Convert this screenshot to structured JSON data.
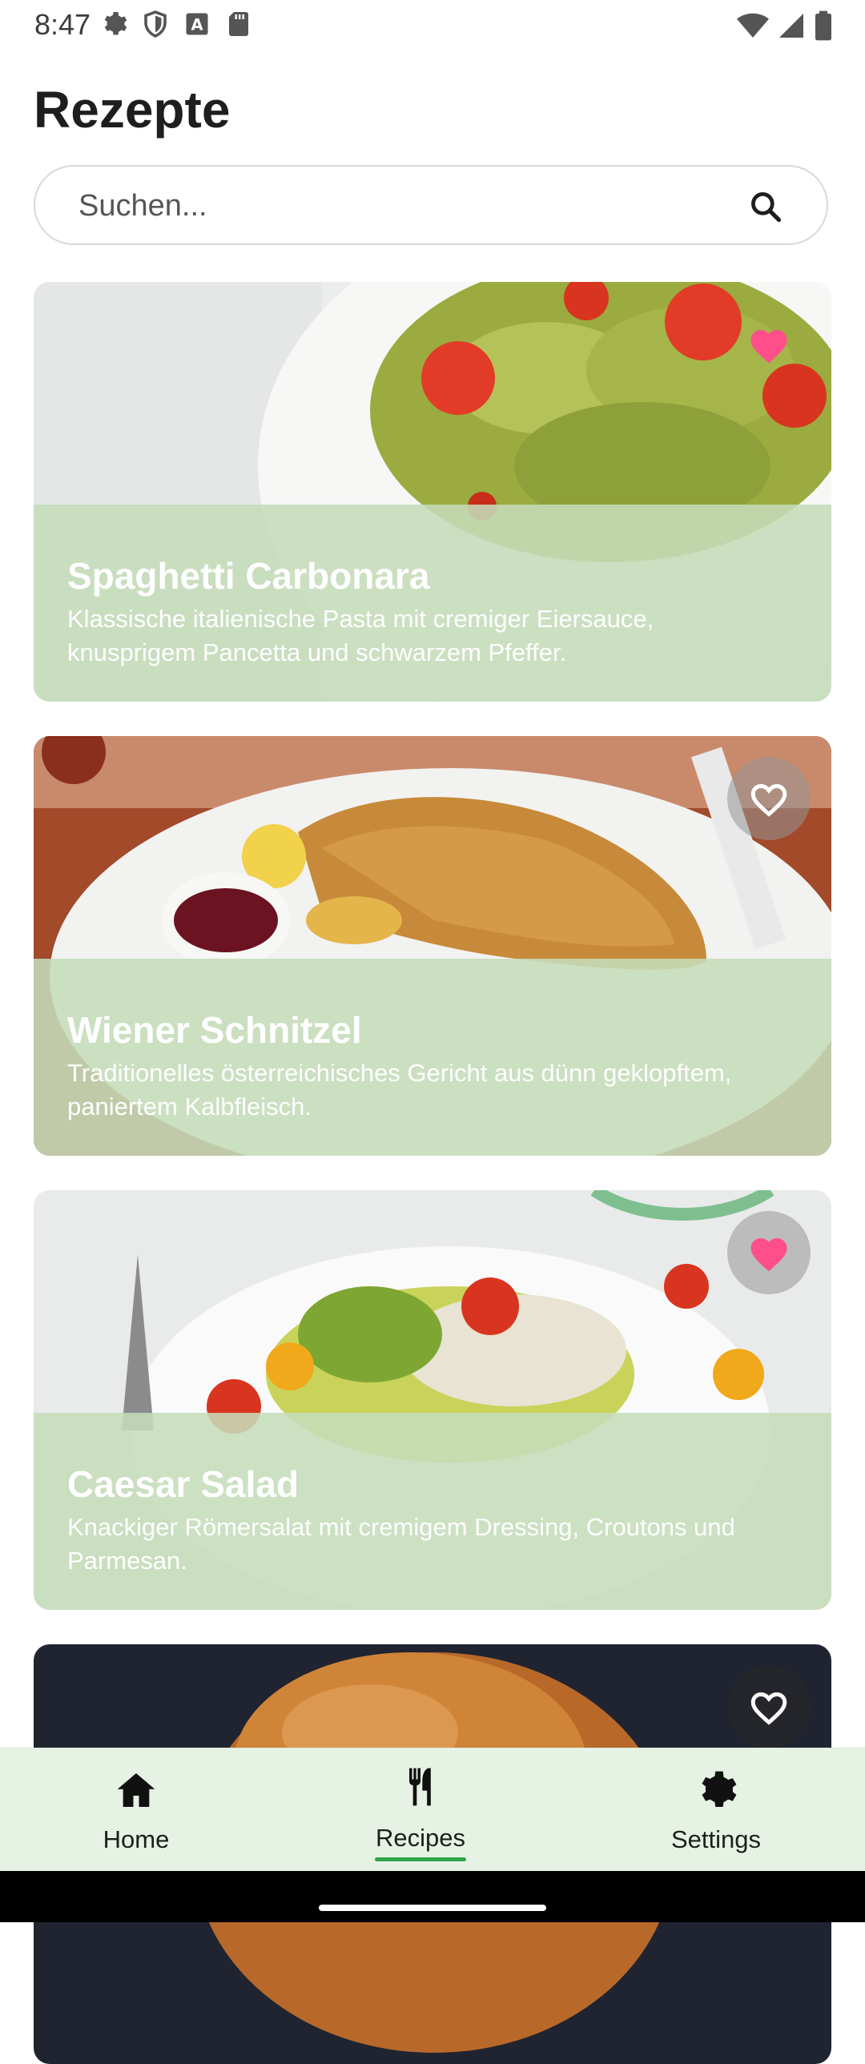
{
  "status_bar": {
    "time": "8:47",
    "left_icons": [
      "settings-icon",
      "shield-icon",
      "text-a-icon",
      "sd-card-icon"
    ],
    "right_icons": [
      "wifi-icon",
      "signal-icon",
      "battery-icon"
    ]
  },
  "header": {
    "title": "Rezepte"
  },
  "search": {
    "placeholder": "Suchen...",
    "value": ""
  },
  "recipes": [
    {
      "title": "Spaghetti Carbonara",
      "description": "Klassische italienische Pasta mit cremiger Eiersauce, knusprigem Pancetta und schwarzem Pfeffer.",
      "favorite": true,
      "image": "pasta-salad-photo"
    },
    {
      "title": "Wiener Schnitzel",
      "description": "Traditionelles österreichisches Gericht aus dünn geklopftem, paniertem Kalbfleisch.",
      "favorite": false,
      "image": "schnitzel-photo"
    },
    {
      "title": "Caesar Salad",
      "description": "Knackiger Römersalat mit cremigem Dressing, Croutons und Parmesan.",
      "favorite": true,
      "image": "caesar-salad-photo"
    },
    {
      "title": "",
      "description": "",
      "favorite": false,
      "image": "bread-photo"
    }
  ],
  "bottom_nav": [
    {
      "label": "Home",
      "icon": "home-icon",
      "active": false
    },
    {
      "label": "Recipes",
      "icon": "fork-knife-icon",
      "active": true
    },
    {
      "label": "Settings",
      "icon": "gear-icon",
      "active": false
    }
  ],
  "colors": {
    "favorite_pink": "#ff4f8b",
    "overlay_green": "#c5dcb9",
    "nav_background": "#e6f3e4",
    "active_indicator": "#2fa54a"
  }
}
